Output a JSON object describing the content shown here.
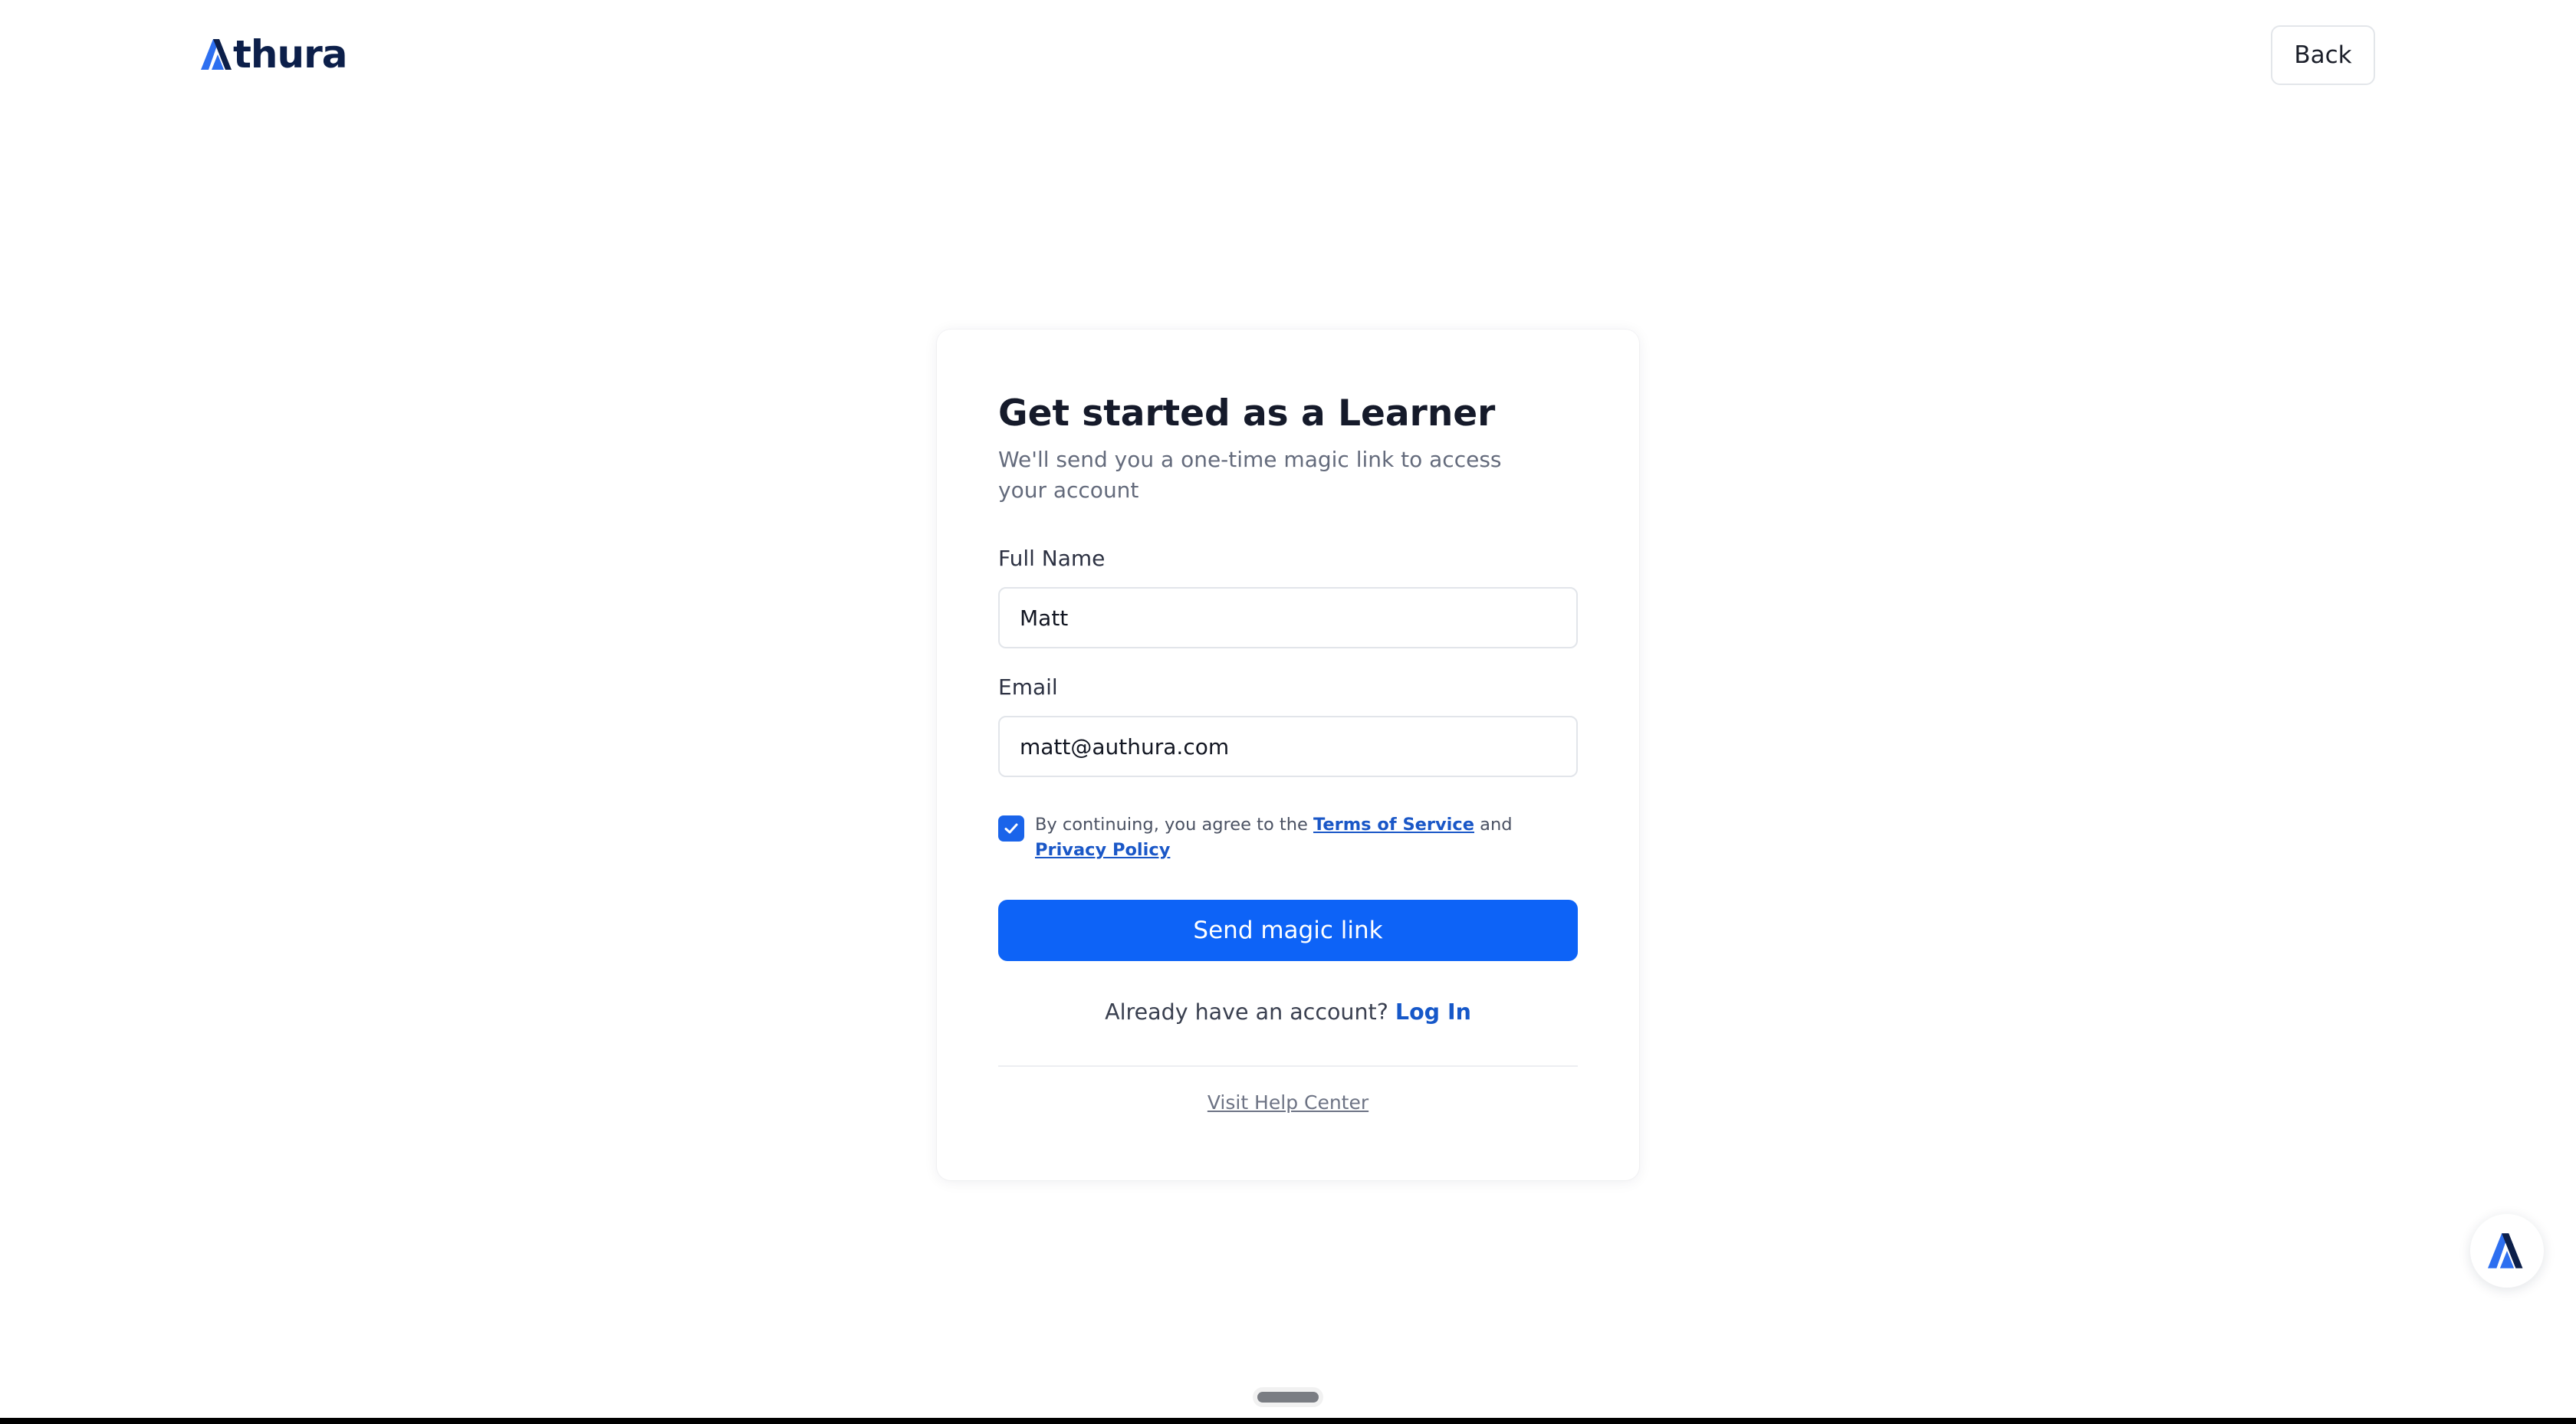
{
  "header": {
    "logo_text_rest": "thura",
    "back_label": "Back"
  },
  "signup": {
    "title": "Get started as a Learner",
    "subtitle": "We'll send you a one-time magic link to access your account",
    "full_name_label": "Full Name",
    "full_name_value": "Matt",
    "email_label": "Email",
    "email_value": "matt@authura.com",
    "consent_checked": true,
    "consent_prefix": "By continuing, you agree to the",
    "terms_link": "Terms of Service",
    "consent_and": "and",
    "privacy_link": "Privacy Policy",
    "send_button": "Send magic link",
    "login_prompt": "Already have an account?",
    "login_link": "Log In",
    "help_link": "Visit Help Center"
  },
  "colors": {
    "primary": "#0d63f7",
    "link": "#1658c9",
    "logo_dark": "#0c1f4a"
  },
  "icons": {
    "logo_mark": "authura-a-logo",
    "fab": "authura-a-logo",
    "checkbox": "checkmark-icon"
  }
}
